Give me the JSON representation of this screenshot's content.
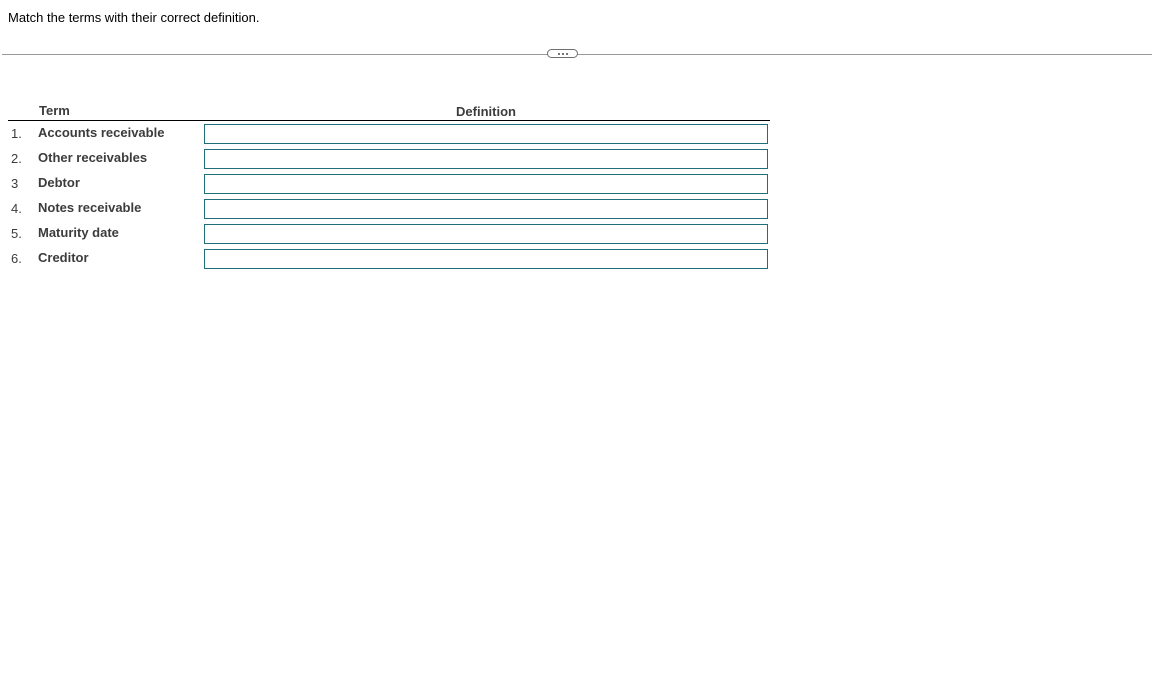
{
  "instruction": "Match the terms with their correct definition.",
  "expand_button": {
    "icon": "ellipsis-icon"
  },
  "table": {
    "header_term": "Term",
    "header_definition": "Definition",
    "rows": [
      {
        "number": "1.",
        "term": "Accounts receivable",
        "definition_value": ""
      },
      {
        "number": "2.",
        "term": "Other receivables",
        "definition_value": ""
      },
      {
        "number": "3",
        "term": "Debtor",
        "definition_value": ""
      },
      {
        "number": "4.",
        "term": "Notes receivable",
        "definition_value": ""
      },
      {
        "number": "5.",
        "term": "Maturity date",
        "definition_value": ""
      },
      {
        "number": "6.",
        "term": "Creditor",
        "definition_value": ""
      }
    ]
  },
  "colors": {
    "input_border": "#1f6e78",
    "divider": "#9a9a9a",
    "label_text": "#3c3c3c"
  }
}
